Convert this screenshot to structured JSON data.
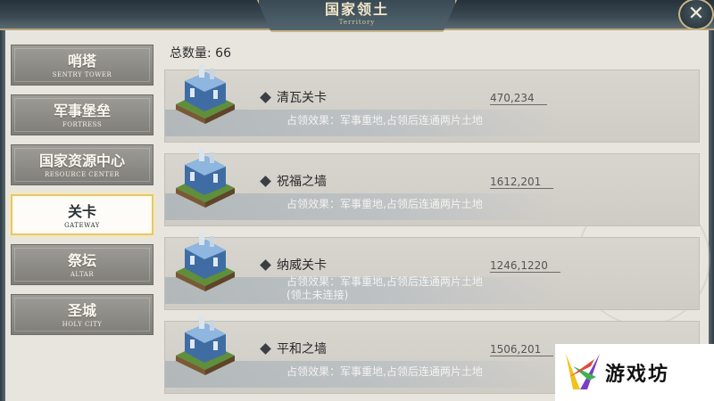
{
  "header": {
    "title": "国家领土",
    "subtitle": "Territory",
    "close_icon": "close-icon"
  },
  "sidebar": {
    "items": [
      {
        "label": "哨塔",
        "sub": "SENTRY TOWER",
        "active": false
      },
      {
        "label": "军事堡垒",
        "sub": "FORTRESS",
        "active": false
      },
      {
        "label": "国家资源中心",
        "sub": "RESOURCE CENTER",
        "active": false
      },
      {
        "label": "关卡",
        "sub": "GATEWAY",
        "active": true
      },
      {
        "label": "祭坛",
        "sub": "ALTAR",
        "active": false
      },
      {
        "label": "圣城",
        "sub": "HOLY CITY",
        "active": false
      }
    ]
  },
  "main": {
    "total_label": "总数量: 66",
    "items": [
      {
        "name": "清瓦关卡",
        "coords": "470,234",
        "effect": "占领效果：军事重地,占领后连通两片土地",
        "note": ""
      },
      {
        "name": "祝福之墙",
        "coords": "1612,201",
        "effect": "占领效果：军事重地,占领后连通两片土地",
        "note": ""
      },
      {
        "name": "纳威关卡",
        "coords": "1246,1220",
        "effect": "占领效果：军事重地,占领后连通两片土地",
        "note": "(领土未连接)"
      },
      {
        "name": "平和之墙",
        "coords": "1506,201",
        "effect": "占领效果：军事重地,占领后连通两片土地",
        "note": ""
      }
    ]
  },
  "watermark": {
    "text": "游戏坊",
    "logo": "game-site-logo-icon"
  },
  "colors": {
    "active_tab_border": "#e6c86a",
    "tab_bg": "#8f8d88",
    "panel_bg": "#e8e5de",
    "header_bg": "#3b4a53"
  }
}
